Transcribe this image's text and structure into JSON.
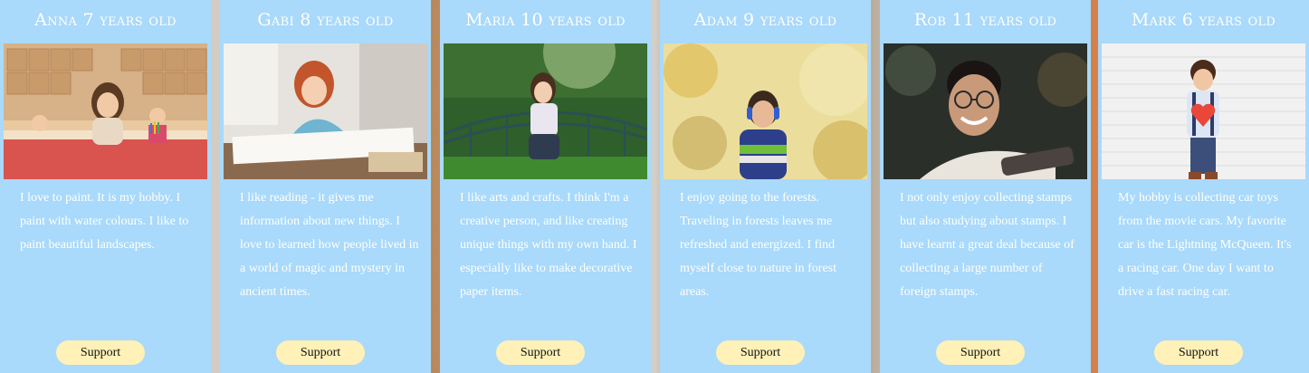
{
  "cards": [
    {
      "title": "Anna 7 years old",
      "photo": "girl-painting-classroom-photo",
      "description": "I love to paint. It is my hobby. I paint with water colours. I like to paint beautiful landscapes.",
      "button": "Support"
    },
    {
      "title": "Gabi 8 years old",
      "photo": "girl-drawing-at-desk-photo",
      "description": "I like reading - it gives me information about new things. I love to learned how people lived in a world of magic and mystery in ancient times.",
      "button": "Support"
    },
    {
      "title": "Maria 10 years old",
      "photo": "girl-sitting-in-park-photo",
      "description": "I like arts and crafts. I think I'm a creative person, and like creating unique things with my own hand. I especially like to make decorative paper items.",
      "button": "Support"
    },
    {
      "title": "Adam 9 years old",
      "photo": "boy-with-headphones-forest-photo",
      "description": "I enjoy going to the forests. Traveling in forests leaves me refreshed and energized. I find myself close to nature in forest areas.",
      "button": "Support"
    },
    {
      "title": "Rob 11 years old",
      "photo": "smiling-boy-with-glasses-photo",
      "description": "I not only enjoy collecting stamps but also studying about stamps. I have learnt a great deal because of collecting a large number of foreign stamps.",
      "button": "Support"
    },
    {
      "title": "Mark 6 years old",
      "photo": "boy-holding-heart-photo",
      "description": "My hobby is collecting car toys from the movie cars. My favorite car is the Lightning McQueen. It's a racing car. One day I want to drive a fast racing car.",
      "button": "Support"
    }
  ],
  "colors": {
    "card_background": "#a9d9fb",
    "button_background": "#fff1b8",
    "title_text": "#ffffff",
    "body_text": "#ffffff"
  }
}
